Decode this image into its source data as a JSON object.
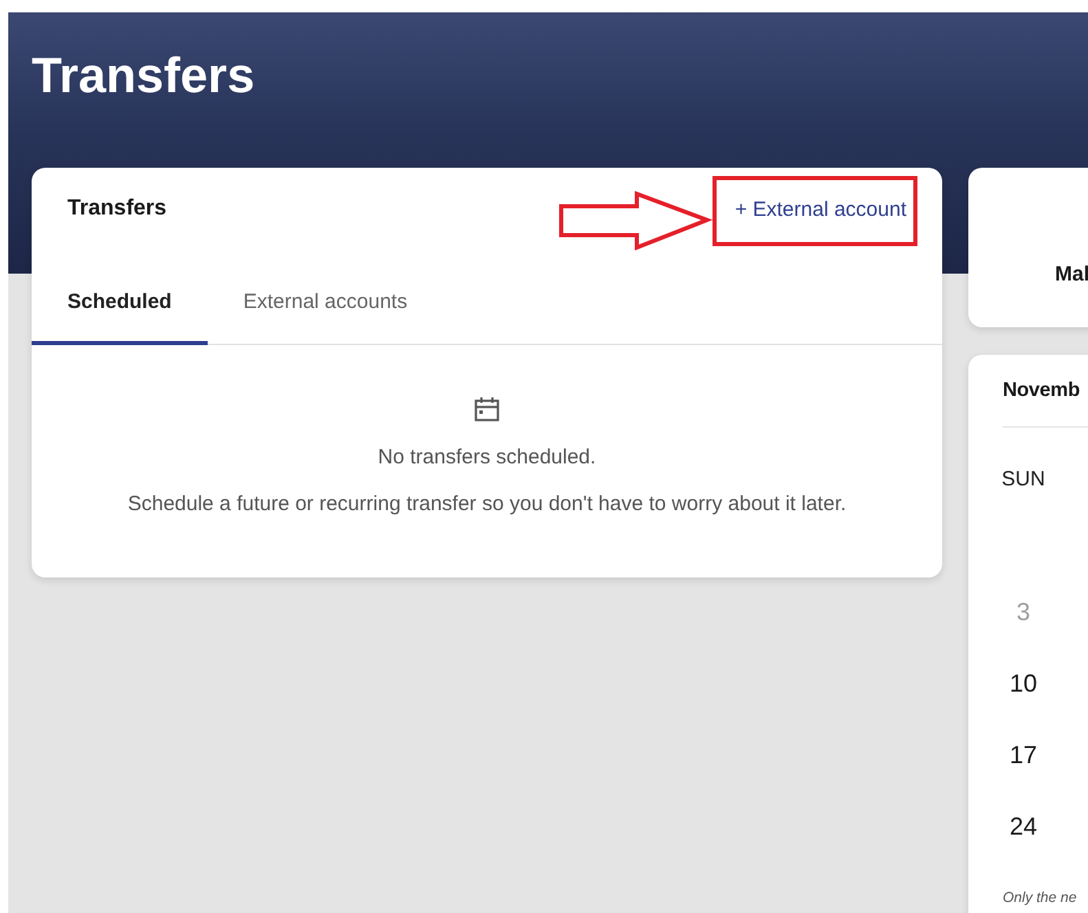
{
  "page": {
    "title": "Transfers"
  },
  "transfers_card": {
    "title": "Transfers",
    "action_link": "+ External account",
    "tabs": [
      {
        "label": "Scheduled",
        "selected": true
      },
      {
        "label": "External accounts",
        "selected": false
      }
    ],
    "empty_state": {
      "heading": "No transfers scheduled.",
      "message": "Schedule a future or recurring transfer so you don't have to worry about it later."
    }
  },
  "annotation": {
    "highlight": true
  },
  "side_card": {
    "text": "Mal"
  },
  "calendar_card": {
    "month": "Novemb",
    "weekday": "SUN",
    "days": [
      {
        "label": "3",
        "muted": true
      },
      {
        "label": "10",
        "muted": false
      },
      {
        "label": "17",
        "muted": false
      },
      {
        "label": "24",
        "muted": false
      }
    ],
    "footnote": "Only the ne"
  }
}
